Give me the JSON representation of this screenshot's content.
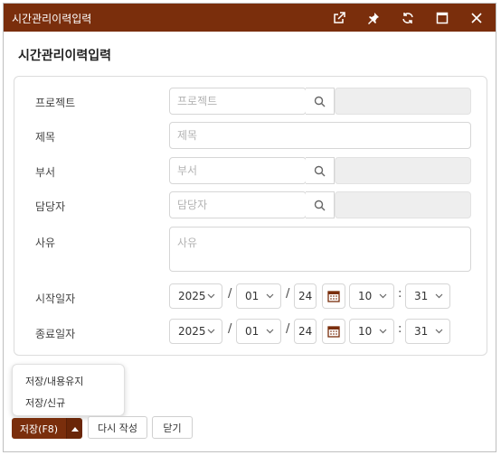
{
  "window": {
    "title": "시간관리이력입력",
    "title_color": "#7a2e0c"
  },
  "page_title": "시간관리이력입력",
  "fields": {
    "project": {
      "label": "프로젝트",
      "placeholder": "프로젝트"
    },
    "subject": {
      "label": "제목",
      "placeholder": "제목"
    },
    "department": {
      "label": "부서",
      "placeholder": "부서"
    },
    "manager": {
      "label": "담당자",
      "placeholder": "담당자"
    },
    "reason": {
      "label": "사유",
      "placeholder": "사유"
    }
  },
  "start": {
    "label": "시작일자",
    "year": "2025",
    "month": "01",
    "day": "24",
    "hour": "10",
    "minute": "31"
  },
  "end": {
    "label": "종료일자",
    "year": "2025",
    "month": "01",
    "day": "24",
    "hour": "10",
    "minute": "31"
  },
  "separators": {
    "date": "/",
    "time": ":"
  },
  "save_menu": {
    "items": [
      "저장/내용유지",
      "저장/신규"
    ]
  },
  "buttons": {
    "save": "저장(F8)",
    "rewrite": "다시 작성",
    "close": "닫기"
  },
  "icons": {
    "titlebar": [
      "external-link-icon",
      "pin-icon",
      "refresh-icon",
      "maximize-icon",
      "close-icon"
    ],
    "search": "search-icon",
    "calendar": "calendar-icon",
    "caret": "caret-up-icon"
  }
}
